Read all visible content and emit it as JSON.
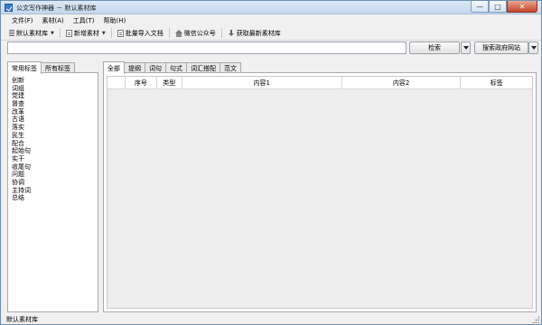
{
  "window": {
    "title": "公文写作神器 － 默认素材库",
    "buttons": {
      "minimize": "—",
      "maximize": "□",
      "close": "✕"
    }
  },
  "menu": [
    "文件(F)",
    "素材(A)",
    "工具(T)",
    "帮助(H)"
  ],
  "toolbar": {
    "library_label": "默认素材库",
    "new_material_label": "新增素材",
    "batch_import_label": "批量导入文档",
    "wechat_label": "微信公众号",
    "fetch_latest_label": "获取最新素材库"
  },
  "search": {
    "value": "",
    "placeholder": "",
    "search_button": "检索",
    "gov_site_button": "搜索政府网站"
  },
  "left_tabs": [
    "常用标签",
    "所有标签"
  ],
  "tags": [
    "创新",
    "词组",
    "党建",
    "督查",
    "改革",
    "古语",
    "落实",
    "民生",
    "配合",
    "起始句",
    "实干",
    "收尾句",
    "问题",
    "协调",
    "主持词",
    "总结"
  ],
  "right_tabs": [
    "全部",
    "提纲",
    "词句",
    "句式",
    "词汇搭配",
    "范文"
  ],
  "table": {
    "columns": [
      "",
      "序号",
      "类型",
      "内容1",
      "内容2",
      "标签",
      ""
    ],
    "rows": []
  },
  "status": {
    "text": "默认素材库"
  }
}
